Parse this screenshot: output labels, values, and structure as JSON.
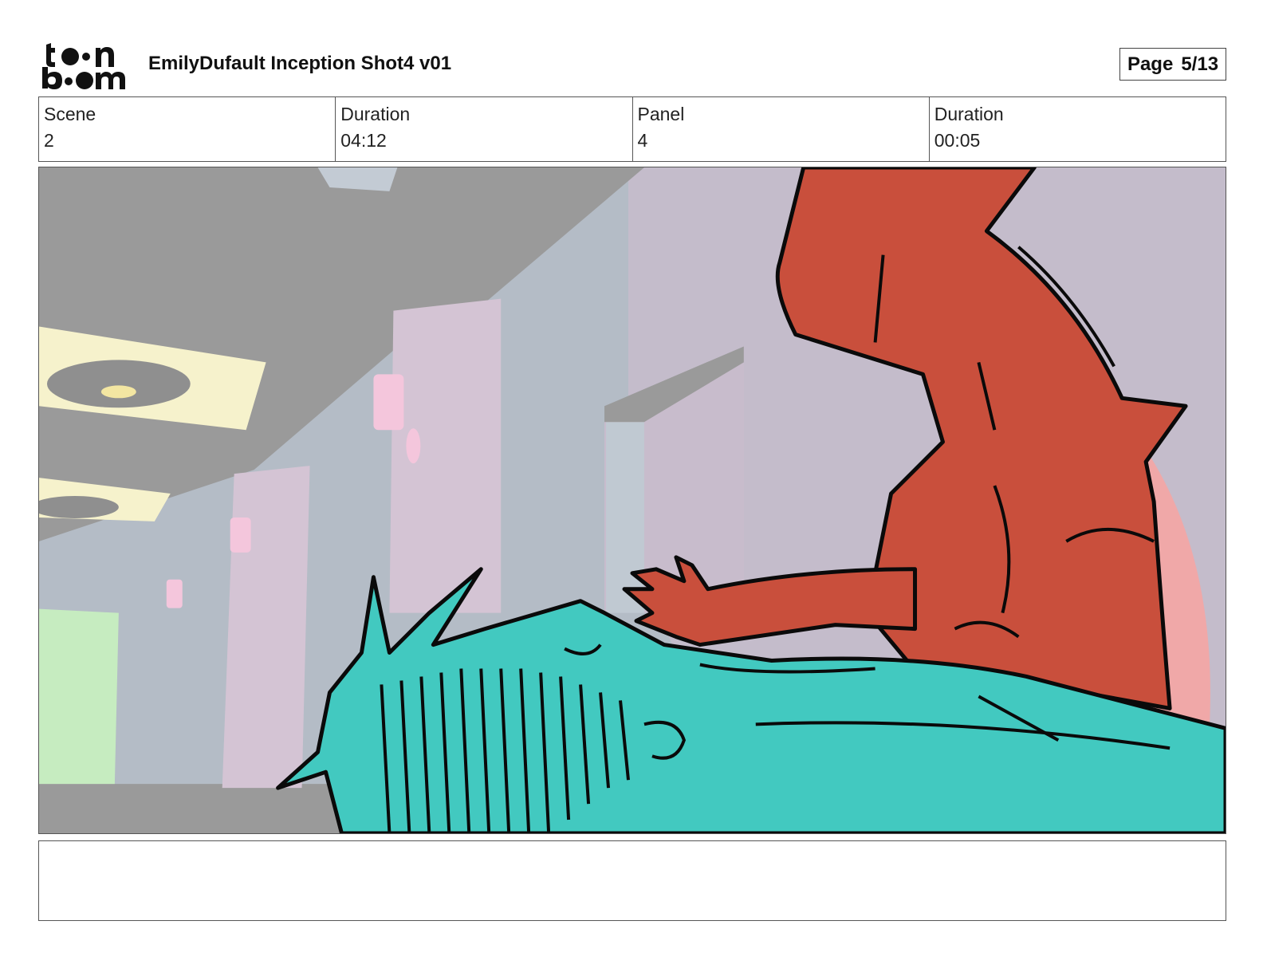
{
  "header": {
    "logo_text": "toon boom",
    "title": "EmilyDufault Inception Shot4 v01",
    "page_label": "Page",
    "page_value": "5/13"
  },
  "info": {
    "scene_label": "Scene",
    "scene_value": "2",
    "scene_duration_label": "Duration",
    "scene_duration_value": "04:12",
    "panel_label": "Panel",
    "panel_value": "4",
    "panel_duration_label": "Duration",
    "panel_duration_value": "00:05"
  },
  "panel_image": {
    "description_icon": "storyboard-panel-drawing",
    "colors": {
      "ceiling": "#9a9a9a",
      "wall": "#b4bcc6",
      "pillar": "#d4c4d4",
      "light": "#f6f2cc",
      "sconce": "#f4c6dc",
      "green_wall": "#c6ecc0",
      "red_character": "#c94f3c",
      "teal_character": "#42c9c0",
      "pink_glow": "#f0a8a8",
      "outline": "#0a0a0a"
    }
  },
  "notes": {
    "text": ""
  }
}
